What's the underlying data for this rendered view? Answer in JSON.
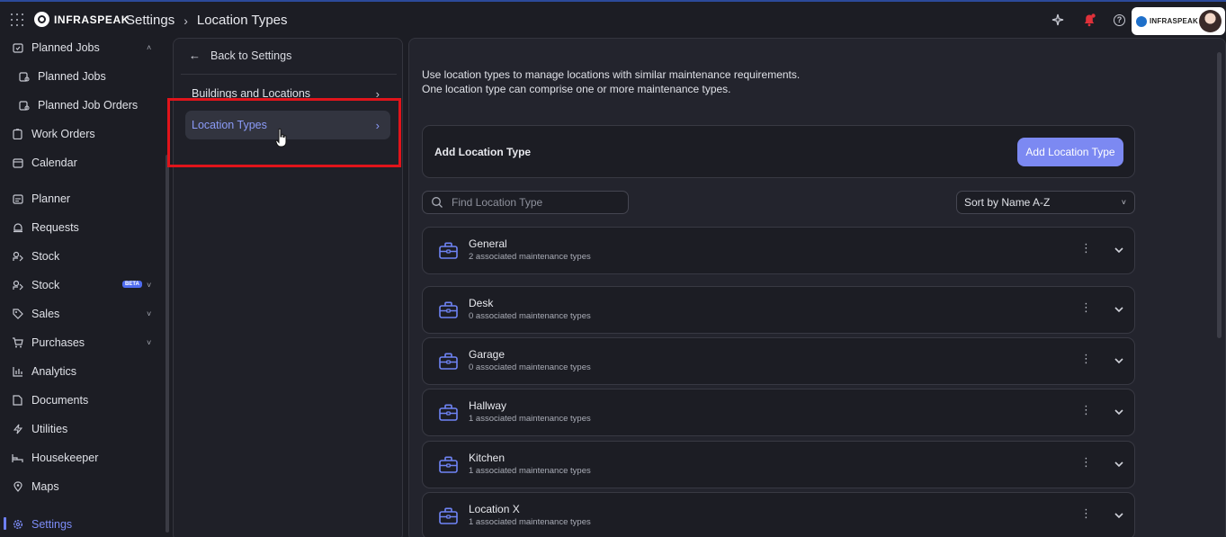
{
  "topbar": {
    "brand": "INFRASPEAK",
    "breadcrumb": [
      "Settings",
      "Location Types"
    ],
    "profile_brand": "INFRASPEAK"
  },
  "sidebar": {
    "items": [
      {
        "label": "Planned Jobs",
        "icon": "calendar-check-icon",
        "sub": false,
        "chevron": "up"
      },
      {
        "label": "Planned Jobs",
        "icon": "calendar-gear-icon",
        "sub": true
      },
      {
        "label": "Planned Job Orders",
        "icon": "calendar-gear-icon",
        "sub": true
      },
      {
        "label": "Work Orders",
        "icon": "clipboard-icon",
        "sub": false
      },
      {
        "label": "Calendar",
        "icon": "calendar-icon",
        "sub": false
      },
      {
        "label": "Planner",
        "icon": "planner-icon",
        "sub": false
      },
      {
        "label": "Requests",
        "icon": "bell-request-icon",
        "sub": false
      },
      {
        "label": "Stock",
        "icon": "stock-icon",
        "sub": false
      },
      {
        "label": "Stock",
        "icon": "stock-icon",
        "sub": false,
        "badge": "BETA",
        "chevron": "down"
      },
      {
        "label": "Sales",
        "icon": "tag-icon",
        "sub": false,
        "chevron": "down"
      },
      {
        "label": "Purchases",
        "icon": "cart-icon",
        "sub": false,
        "chevron": "down"
      },
      {
        "label": "Analytics",
        "icon": "bar-chart-icon",
        "sub": false
      },
      {
        "label": "Documents",
        "icon": "document-icon",
        "sub": false
      },
      {
        "label": "Utilities",
        "icon": "bolt-icon",
        "sub": false
      },
      {
        "label": "Housekeeper",
        "icon": "bed-icon",
        "sub": false
      },
      {
        "label": "Maps",
        "icon": "map-pin-icon",
        "sub": false
      },
      {
        "label": "Settings",
        "icon": "gear-icon",
        "sub": false,
        "active": true
      }
    ]
  },
  "settings_nav": {
    "back_label": "Back to Settings",
    "items": [
      {
        "label": "Buildings and Locations"
      },
      {
        "label": "Location Types",
        "active": true
      }
    ]
  },
  "main": {
    "intro_line1": "Use location types to manage locations with similar maintenance requirements.",
    "intro_line2": "One location type can comprise one or more maintenance types.",
    "add_title": "Add Location Type",
    "add_button": "Add Location Type",
    "search_placeholder": "Find Location Type",
    "sort_label": "Sort by Name A-Z",
    "location_types": [
      {
        "name": "General",
        "sub": "2 associated maintenance types"
      },
      {
        "name": "Desk",
        "sub": "0 associated maintenance types"
      },
      {
        "name": "Garage",
        "sub": "0 associated maintenance types"
      },
      {
        "name": "Hallway",
        "sub": "1 associated maintenance types"
      },
      {
        "name": "Kitchen",
        "sub": "1 associated maintenance types"
      },
      {
        "name": "Location X",
        "sub": "1 associated maintenance types"
      }
    ]
  },
  "colors": {
    "accent": "#7c89f2",
    "active_text": "#8b9bf8",
    "highlight": "#e0141b",
    "background": "#1c1d24"
  }
}
